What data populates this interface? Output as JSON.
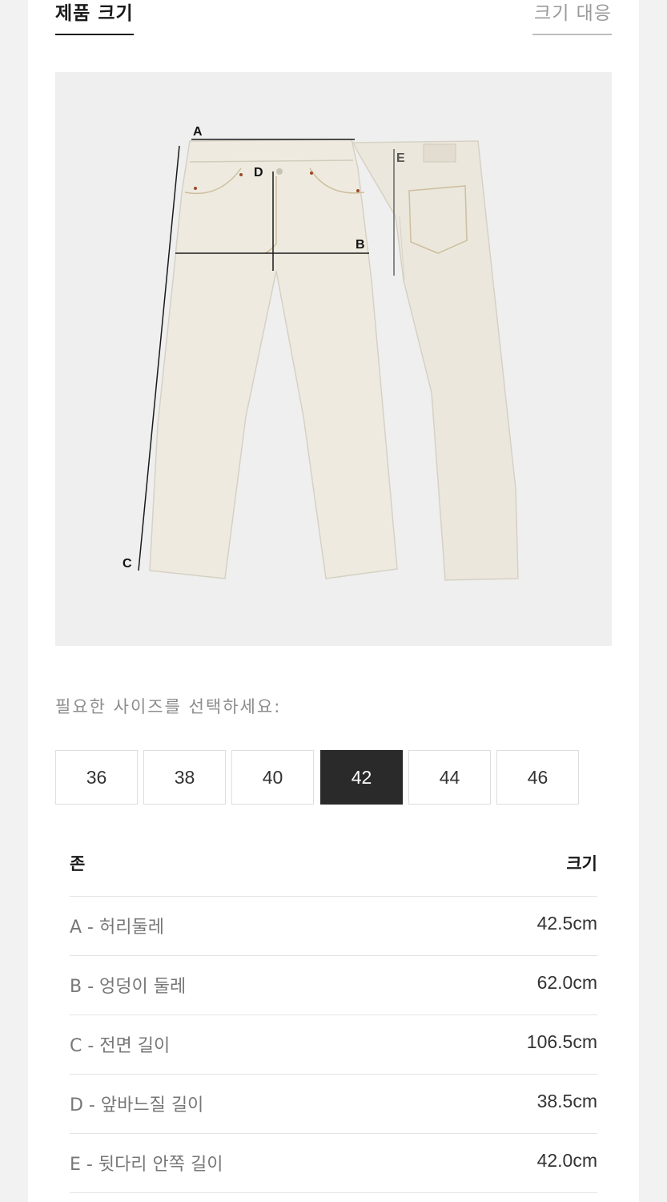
{
  "tabs": {
    "product_size": "제품 크기",
    "size_guide": "크기 대응"
  },
  "diagram": {
    "labels": {
      "a": "A",
      "b": "B",
      "c": "C",
      "d": "D",
      "e": "E"
    }
  },
  "size_select": {
    "prompt": "필요한 사이즈를 선택하세요:",
    "options": [
      "36",
      "38",
      "40",
      "42",
      "44",
      "46"
    ],
    "selected": "42"
  },
  "table": {
    "header_zone": "존",
    "header_size": "크기",
    "rows": [
      {
        "zone": "A - 허리둘레",
        "value": "42.5cm"
      },
      {
        "zone": "B - 엉덩이 둘레",
        "value": "62.0cm"
      },
      {
        "zone": "C - 전면 길이",
        "value": "106.5cm"
      },
      {
        "zone": "D - 앞바느질 길이",
        "value": "38.5cm"
      },
      {
        "zone": "E - 뒷다리 안쪽 길이",
        "value": "42.0cm"
      }
    ]
  },
  "colors": {
    "selected_bg": "#2a2a2a",
    "jeans": "#eeeadf",
    "figure_bg": "#efefef"
  }
}
